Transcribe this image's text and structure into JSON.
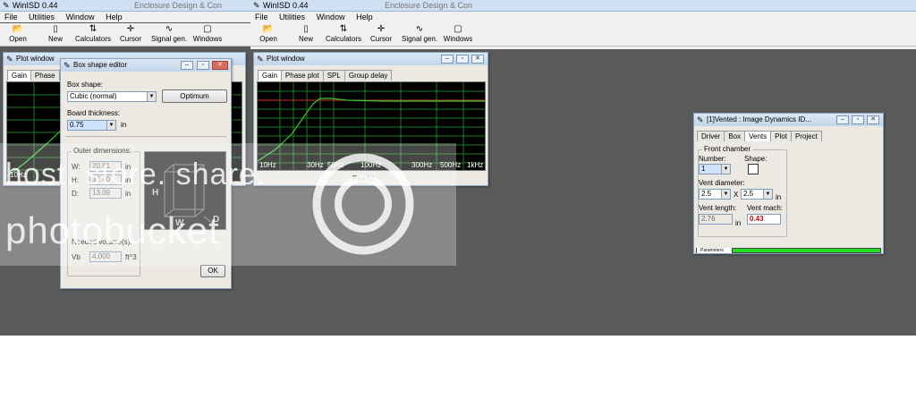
{
  "left_app": {
    "title": "WinISD 0.44",
    "ghost_tab": "Enclosure Design & Con",
    "menu": [
      "File",
      "Utilities",
      "Window",
      "Help"
    ],
    "toolbar": [
      "Open",
      "New",
      "Calculators",
      "Cursor",
      "Signal gen.",
      "Windows"
    ],
    "plot_window": {
      "title": "Plot window",
      "tabs": [
        "Gain",
        "Phase"
      ],
      "x_ticks": [
        "10Hz"
      ]
    }
  },
  "box_editor": {
    "title": "Box shape editor",
    "box_shape_label": "Box shape:",
    "box_shape_value": "Cubic (normal)",
    "optimum_label": "Optimum",
    "thickness_label": "Board thickness:",
    "thickness_value": "0.75",
    "thickness_unit": "in",
    "outer_label": "Outer dimensions:",
    "w_label": "W:",
    "w_value": "20.81",
    "w_unit": "in",
    "h_label": "H:",
    "h_value": "32.40",
    "h_unit": "in",
    "d_label": "D:",
    "d_value": "13.09",
    "d_unit": "in",
    "needed_label": "Needed volume(s):",
    "vb_label": "Vb",
    "vb_value": "4.000",
    "vb_unit": "ft^3",
    "diag_h": "H",
    "diag_w": "W",
    "diag_d": "D",
    "ok_label": "OK"
  },
  "right_app": {
    "title": "WinISD 0.44",
    "ghost_tab": "Enclosure Design & Con",
    "menu": [
      "File",
      "Utilities",
      "Window",
      "Help"
    ],
    "toolbar": [
      "Open",
      "New",
      "Calculators",
      "Cursor",
      "Signal gen.",
      "Windows"
    ]
  },
  "plot_window2": {
    "title": "Plot window",
    "tabs": [
      "Gain",
      "Phase plot",
      "SPL",
      "Group delay"
    ],
    "x_ticks": [
      "10Hz",
      "30Hz",
      "50Hz",
      "100Hz",
      "300Hz",
      "500Hz",
      "1kHz"
    ],
    "status": "Ready.."
  },
  "vented": {
    "title": "[1]Vented : Image Dynamics ID...",
    "tabs": [
      "Driver",
      "Box",
      "Vents",
      "Plot",
      "Project"
    ],
    "front_chamber_label": "Front chamber",
    "number_label": "Number:",
    "number_value": "1",
    "shape_label": "Shape:",
    "vent_diameter_label": "Vent diameter:",
    "diam1": "2.5",
    "diam_x": "X",
    "diam2": "2.5",
    "diam_unit": "in",
    "vent_length_label": "Vent length:",
    "vent_length_value": "2.76",
    "vent_length_unit": "in",
    "vent_mach_label": "Vent mach:",
    "vent_mach_value": "0.43",
    "status_tab": "Parameters"
  },
  "watermark": {
    "line1": "host. store. share.",
    "line2": "photobucket"
  },
  "colors": {
    "desktop": "#5a5a5a",
    "plot_bg": "#000000",
    "grid": "#1e7a1e",
    "curve": "#33cc33",
    "mach_red": "#cc0000",
    "progress": "#22dd22"
  }
}
